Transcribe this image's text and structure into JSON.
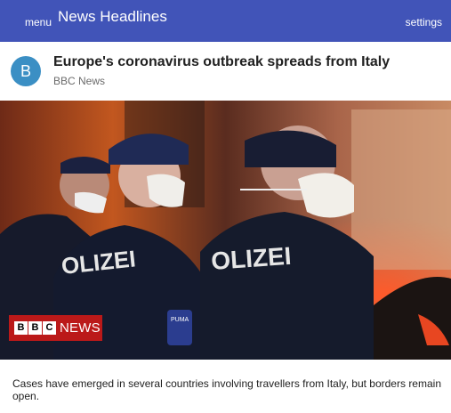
{
  "topbar": {
    "menu_label": "menu",
    "title": "News Headlines",
    "settings_label": "settings",
    "background_color": "#4154b8"
  },
  "article": {
    "avatar_letter": "B",
    "headline": "Europe's coronavirus outbreak spreads from Italy",
    "source": "BBC News",
    "image": {
      "badge_letters": [
        "B",
        "B",
        "C"
      ],
      "badge_text": "NEWS",
      "police_text": "POLIZEI"
    },
    "summary": "Cases have emerged in several countries involving travellers from Italy, but borders remain open."
  }
}
